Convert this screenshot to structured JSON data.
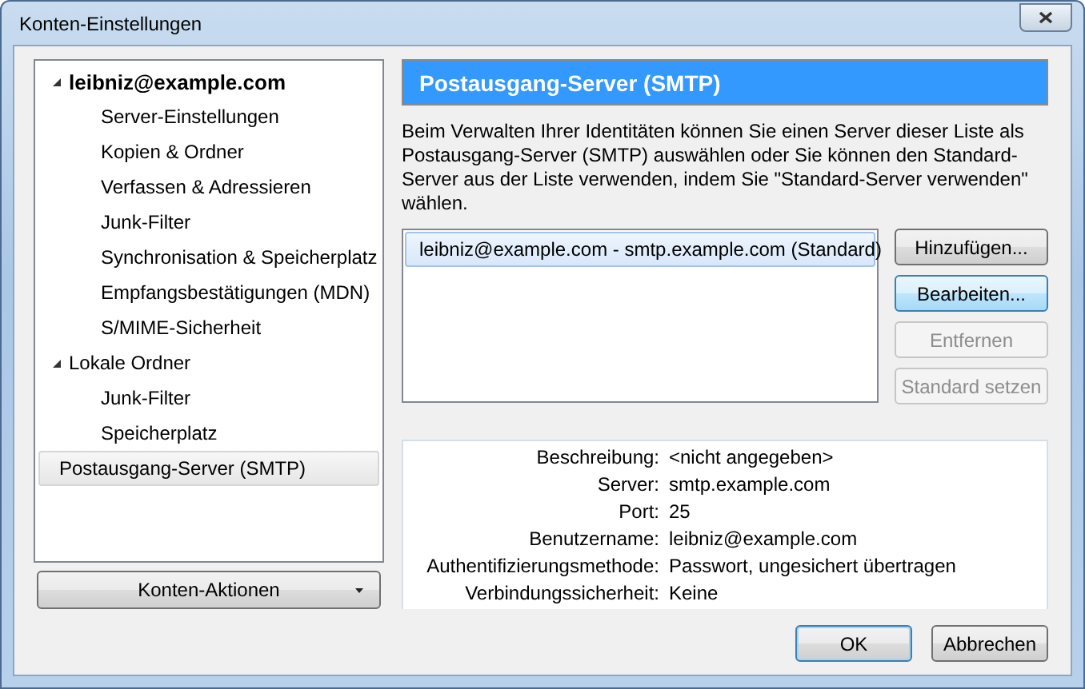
{
  "window": {
    "title": "Konten-Einstellungen"
  },
  "sidebar": {
    "items": [
      {
        "label": "leibniz@example.com",
        "kind": "account",
        "expanded": true,
        "selected": false,
        "children": [
          {
            "label": "Server-Einstellungen",
            "selected": false
          },
          {
            "label": "Kopien & Ordner",
            "selected": false
          },
          {
            "label": "Verfassen & Adressieren",
            "selected": false
          },
          {
            "label": "Junk-Filter",
            "selected": false
          },
          {
            "label": "Synchronisation & Speicherplatz",
            "selected": false
          },
          {
            "label": "Empfangsbestätigungen (MDN)",
            "selected": false
          },
          {
            "label": "S/MIME-Sicherheit",
            "selected": false
          }
        ]
      },
      {
        "label": "Lokale Ordner",
        "kind": "folder",
        "expanded": true,
        "selected": false,
        "children": [
          {
            "label": "Junk-Filter",
            "selected": false
          },
          {
            "label": "Speicherplatz",
            "selected": false
          }
        ]
      },
      {
        "label": "Postausgang-Server (SMTP)",
        "kind": "page",
        "selected": true
      }
    ],
    "actions_button": {
      "label": "Konten-Aktionen"
    }
  },
  "panel": {
    "title": "Postausgang-Server (SMTP)",
    "description": "Beim Verwalten Ihrer Identitäten können Sie einen Server dieser Liste als Postausgang-Server (SMTP) auswählen oder Sie können den Standard-Server aus der Liste verwenden, indem Sie \"Standard-Server verwenden\" wählen.",
    "servers": [
      {
        "label": "leibniz@example.com - smtp.example.com (Standard)",
        "selected": true
      }
    ],
    "buttons": [
      {
        "label": "Hinzufügen...",
        "disabled": false,
        "focused": false
      },
      {
        "label": "Bearbeiten...",
        "disabled": false,
        "focused": true
      },
      {
        "label": "Entfernen",
        "disabled": true,
        "focused": false
      },
      {
        "label": "Standard setzen",
        "disabled": true,
        "focused": false
      }
    ],
    "details": [
      {
        "label": "Beschreibung:",
        "value": "<nicht angegeben>"
      },
      {
        "label": "Server:",
        "value": "smtp.example.com"
      },
      {
        "label": "Port:",
        "value": "25"
      },
      {
        "label": "Benutzername:",
        "value": "leibniz@example.com"
      },
      {
        "label": "Authentifizierungsmethode:",
        "value": "Passwort, ungesichert übertragen"
      },
      {
        "label": "Verbindungssicherheit:",
        "value": "Keine"
      }
    ]
  },
  "dialog_buttons": [
    {
      "label": "OK",
      "default": true
    },
    {
      "label": "Abbrechen",
      "default": false
    }
  ]
}
